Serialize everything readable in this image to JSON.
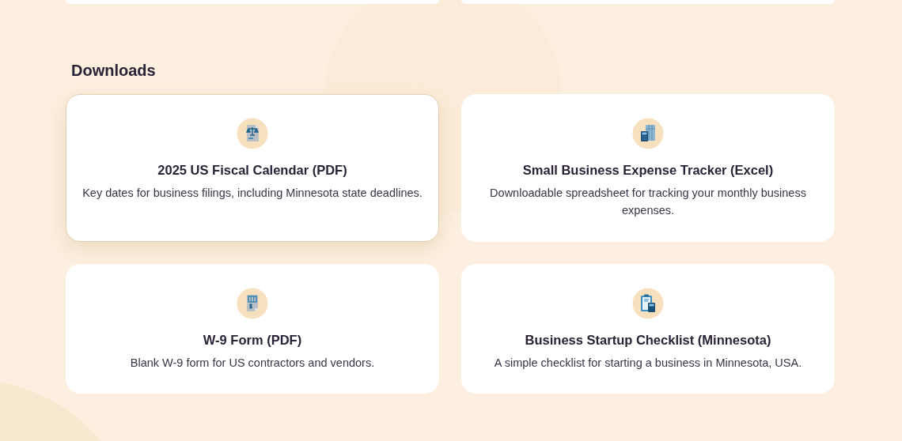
{
  "section_title": "Downloads",
  "downloads": [
    {
      "title": "2025 US Fiscal Calendar (PDF)",
      "description": "Key dates for business filings, including Minnesota state deadlines.",
      "selected": true
    },
    {
      "title": "Small Business Expense Tracker (Excel)",
      "description": "Downloadable spreadsheet for tracking your monthly business expenses.",
      "selected": false
    },
    {
      "title": "W-9 Form (PDF)",
      "description": "Blank W-9 form for US contractors and vendors.",
      "selected": false
    },
    {
      "title": "Business Startup Checklist (Minnesota)",
      "description": "A simple checklist for starting a business in Minnesota, USA.",
      "selected": false
    }
  ]
}
